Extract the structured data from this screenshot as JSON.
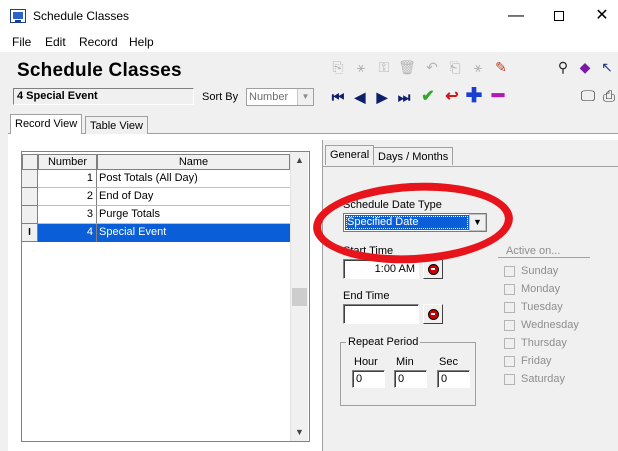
{
  "window": {
    "title": "Schedule Classes",
    "minimize": "—",
    "close": "✕"
  },
  "menu": [
    "File",
    "Edit",
    "Record",
    "Help"
  ],
  "header": {
    "title": "Schedule Classes",
    "current_record": "4 Special Event",
    "sort_by_label": "Sort By",
    "sort_by_value": "Number"
  },
  "tabs": {
    "record_view": "Record View",
    "table_view": "Table View",
    "general": "General",
    "days_months": "Days / Months"
  },
  "grid": {
    "columns": [
      "Number",
      "Name"
    ],
    "rows": [
      {
        "number": "1",
        "name": "Post Totals (All Day)",
        "indicator": ""
      },
      {
        "number": "2",
        "name": "End of Day",
        "indicator": ""
      },
      {
        "number": "3",
        "name": "Purge Totals",
        "indicator": ""
      },
      {
        "number": "4",
        "name": "Special Event",
        "indicator": "I"
      }
    ],
    "selected_index": 3
  },
  "general": {
    "schedule_date_type_label": "Schedule Date Type",
    "schedule_date_type_value": "Specified Date",
    "start_time_label": "Start Time",
    "start_time_value": "1:00 AM",
    "end_time_label": "End Time",
    "end_time_value": "",
    "repeat_period_label": "Repeat Period",
    "hour_label": "Hour",
    "hour_value": "0",
    "min_label": "Min",
    "min_value": "0",
    "sec_label": "Sec",
    "sec_value": "0",
    "active_on_label": "Active on...",
    "days": [
      "Sunday",
      "Monday",
      "Tuesday",
      "Wednesday",
      "Thursday",
      "Friday",
      "Saturday"
    ]
  },
  "colors": {
    "selection": "#0a5fd8",
    "highlight_ring": "#e8141b",
    "nav_icons": "#0c1f6b"
  },
  "icons": [
    "app-icon",
    "find-binoculars-icon",
    "book-icon",
    "help-pointer-icon",
    "monitor-icon"
  ]
}
